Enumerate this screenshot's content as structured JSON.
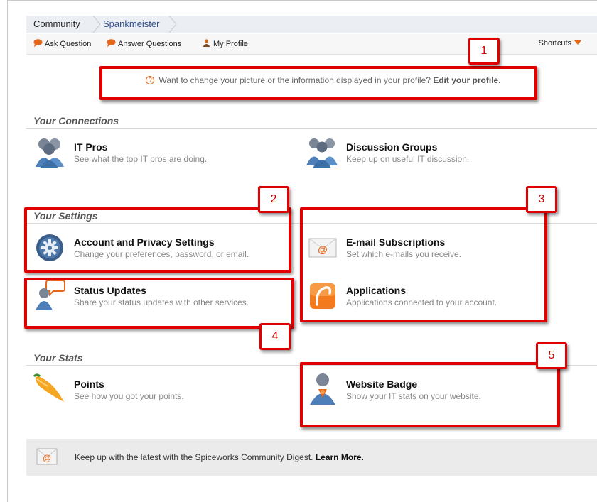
{
  "breadcrumb": {
    "items": [
      "Community",
      "Spankmeister"
    ]
  },
  "toolbar": {
    "ask_question": "Ask Question",
    "answer_questions": "Answer Questions",
    "my_profile": "My Profile",
    "shortcuts": "Shortcuts"
  },
  "notice": {
    "text": "Want to change your picture or the information displayed in your profile?",
    "link": "Edit your profile."
  },
  "sections": {
    "connections": "Your Connections",
    "settings": "Your Settings",
    "stats": "Your Stats"
  },
  "items": {
    "it_pros": {
      "title": "IT Pros",
      "desc": "See what the top IT pros are doing."
    },
    "discussion_groups": {
      "title": "Discussion Groups",
      "desc": "Keep up on useful IT discussion."
    },
    "account_privacy": {
      "title": "Account and Privacy Settings",
      "desc": "Change your preferences, password, or email."
    },
    "email_subscriptions": {
      "title": "E-mail Subscriptions",
      "desc": "Set which e-mails you receive."
    },
    "status_updates": {
      "title": "Status Updates",
      "desc": "Share your status updates with other services."
    },
    "applications": {
      "title": "Applications",
      "desc": "Applications connected to your account."
    },
    "points": {
      "title": "Points",
      "desc": "See how you got your points."
    },
    "website_badge": {
      "title": "Website Badge",
      "desc": "Show your IT stats on your website."
    }
  },
  "digest": {
    "text": "Keep up with the latest with the Spiceworks Community Digest.",
    "link": "Learn More."
  },
  "callouts": [
    "1",
    "2",
    "3",
    "4",
    "5"
  ],
  "colors": {
    "annotation_red": "#e00000",
    "accent_orange": "#e8661a",
    "link_blue": "#2f4f8f"
  }
}
